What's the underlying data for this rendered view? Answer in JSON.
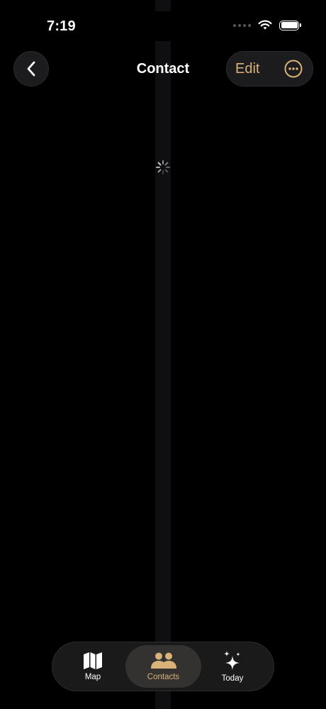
{
  "status_bar": {
    "time": "7:19"
  },
  "nav": {
    "title": "Contact",
    "edit_label": "Edit"
  },
  "tab_bar": {
    "tabs": [
      {
        "label": "Map",
        "icon": "map-icon",
        "selected": false
      },
      {
        "label": "Contacts",
        "icon": "people-icon",
        "selected": true
      },
      {
        "label": "Today",
        "icon": "sparkles-icon",
        "selected": false
      }
    ]
  },
  "colors": {
    "background": "#000000",
    "accent": "#d9b27a",
    "surface": "#1c1c1e",
    "text": "#ffffff"
  }
}
